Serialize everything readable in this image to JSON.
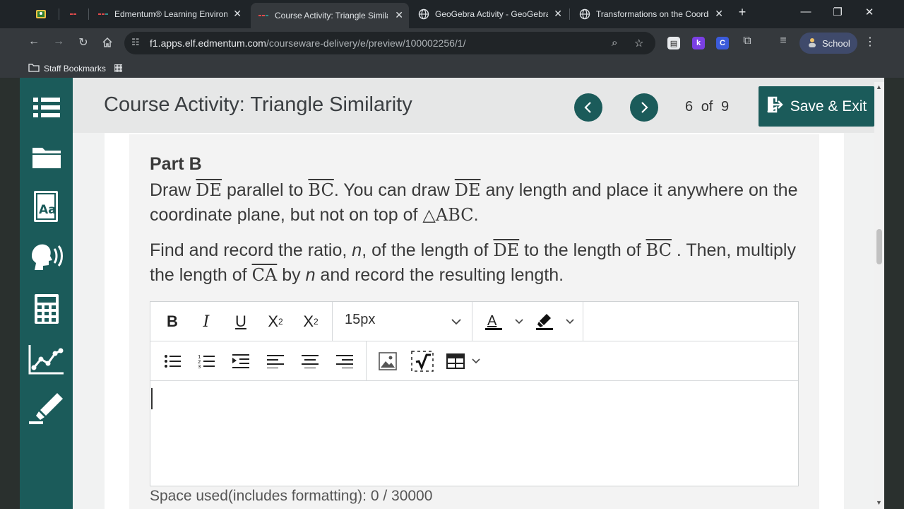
{
  "browser": {
    "tabs": [
      {
        "label": "",
        "icon": "classroom-icon"
      },
      {
        "label": "",
        "icon": "edmentum-icon"
      },
      {
        "label": "Edmentum® Learning Environm",
        "icon": "edmentum-icon"
      },
      {
        "label": "Course Activity: Triangle Similar",
        "icon": "edmentum-icon",
        "active": true
      },
      {
        "label": "GeoGebra Activity - GeoGebra I",
        "icon": "globe-icon"
      },
      {
        "label": "Transformations on the Coordin",
        "icon": "globe-icon"
      }
    ],
    "url_host": "f1.apps.elf.edmentum.com",
    "url_path": "/courseware-delivery/e/preview/100002256/1/",
    "extensions": [
      "k",
      "C"
    ],
    "profile_label": "School",
    "bookmarks_label": "Staff Bookmarks"
  },
  "header": {
    "title": "Course Activity: Triangle Similarity",
    "page_current": "6",
    "page_of": "of",
    "page_total": "9",
    "save_exit_label": "Save & Exit"
  },
  "question": {
    "part_label": "Part B",
    "p1": {
      "t1": "Draw ",
      "m1": "DE",
      "t2": " parallel to ",
      "m2": "BC",
      "t3": ". You can draw ",
      "m3": "DE",
      "t4": " any length and place it anywhere on the coordinate plane, but not on top of ",
      "m4": "△ABC",
      "t5": "."
    },
    "p2": {
      "t1": "Find and record the ratio, ",
      "n1": "n",
      "t2": ", of the length of ",
      "m1": "DE",
      "t3": " to the length of ",
      "m2": "BC",
      "t4": " . Then, multiply the length of ",
      "m3": "CA",
      "t5": " by ",
      "n2": "n",
      "t6": " and record the resulting length."
    }
  },
  "editor": {
    "font_size": "15px",
    "content": "",
    "space_used_text": "Space used(includes formatting): 0 / 30000"
  },
  "colors": {
    "brand_teal": "#1b5b5a",
    "header_bg": "#e6e7e7"
  }
}
